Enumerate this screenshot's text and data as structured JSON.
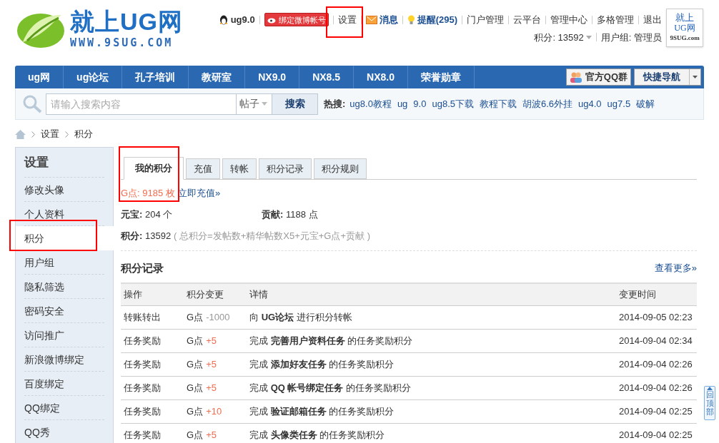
{
  "logo": {
    "title": "就上UG网",
    "url": "WWW.9SUG.COM"
  },
  "header": {
    "user": "ug9.0",
    "weibo_button": "绑定微博帐号",
    "links": [
      {
        "text": "设置",
        "kind": "plain"
      },
      {
        "text": "消息",
        "kind": "message"
      },
      {
        "text": "提醒(295)",
        "kind": "reminder"
      },
      {
        "text": "门户管理",
        "kind": "plain"
      },
      {
        "text": "云平台",
        "kind": "plain"
      },
      {
        "text": "管理中心",
        "kind": "plain"
      },
      {
        "text": "多格管理",
        "kind": "plain"
      },
      {
        "text": "退出",
        "kind": "plain"
      }
    ],
    "points": "积分: 13592",
    "usergroup": "用户组: 管理员",
    "badge": [
      "就上",
      "UG网",
      "9SUG.com"
    ]
  },
  "nav": {
    "items": [
      "ug网",
      "ug论坛",
      "孔子培训",
      "教研室",
      "NX9.0",
      "NX8.5",
      "NX8.0",
      "荣誉勋章"
    ],
    "qq_group": "官方QQ群",
    "quick_nav": "快捷导航"
  },
  "search": {
    "placeholder": "请输入搜索内容",
    "type": "帖子",
    "button": "搜索",
    "hot_label": "热搜:",
    "hot": [
      "ug8.0教程",
      "ug",
      "9.0",
      "ug8.5下载",
      "教程下载",
      "胡波6.6外挂",
      "ug4.0",
      "ug7.5",
      "破解"
    ]
  },
  "breadcrumb": [
    "设置",
    "积分"
  ],
  "sidebar": {
    "title": "设置",
    "items": [
      {
        "label": "修改头像",
        "selected": false
      },
      {
        "label": "个人资料",
        "selected": false
      },
      {
        "label": "积分",
        "selected": true
      },
      {
        "label": "用户组",
        "selected": false
      },
      {
        "label": "隐私筛选",
        "selected": false
      },
      {
        "label": "密码安全",
        "selected": false
      },
      {
        "label": "访问推广",
        "selected": false
      },
      {
        "label": "新浪微博绑定",
        "selected": false
      },
      {
        "label": "百度绑定",
        "selected": false
      },
      {
        "label": "QQ绑定",
        "selected": false
      },
      {
        "label": "QQ秀",
        "selected": false
      }
    ]
  },
  "tabs": [
    {
      "label": "我的积分",
      "selected": true
    },
    {
      "label": "充值",
      "selected": false
    },
    {
      "label": "转帐",
      "selected": false
    },
    {
      "label": "积分记录",
      "selected": false
    },
    {
      "label": "积分规则",
      "selected": false
    }
  ],
  "gpoints": "G点: 9185 枚",
  "recharge_link": "立即充值»",
  "stats": [
    {
      "label": "元宝:",
      "value": "204 个"
    },
    {
      "label": "贡献:",
      "value": "1188 点"
    }
  ],
  "score": {
    "label": "积分:",
    "value": "13592",
    "formula": "( 总积分=发帖数+精华帖数X5+元宝+G点+贡献 )"
  },
  "records": {
    "title": "积分记录",
    "more": "查看更多»",
    "columns": [
      "操作",
      "积分变更",
      "详情",
      "变更时间"
    ],
    "rows": [
      {
        "action": "转账转出",
        "unit": "G点",
        "change": "-1000",
        "kind": "debit",
        "detail": "向 **UG论坛** 进行积分转帐",
        "time": "2014-09-05 02:23"
      },
      {
        "action": "任务奖励",
        "unit": "G点",
        "change": "+5",
        "kind": "credit",
        "detail": "完成 **完善用户资料任务** 的任务奖励积分",
        "time": "2014-09-04 02:34"
      },
      {
        "action": "任务奖励",
        "unit": "G点",
        "change": "+5",
        "kind": "credit",
        "detail": "完成 **添加好友任务** 的任务奖励积分",
        "time": "2014-09-04 02:26"
      },
      {
        "action": "任务奖励",
        "unit": "G点",
        "change": "+5",
        "kind": "credit",
        "detail": "完成 **QQ 帐号绑定任务** 的任务奖励积分",
        "time": "2014-09-04 02:26"
      },
      {
        "action": "任务奖励",
        "unit": "G点",
        "change": "+10",
        "kind": "credit",
        "detail": "完成 **验证邮箱任务** 的任务奖励积分",
        "time": "2014-09-04 02:25"
      },
      {
        "action": "任务奖励",
        "unit": "G点",
        "change": "+5",
        "kind": "credit",
        "detail": "完成 **头像类任务** 的任务奖励积分",
        "time": "2014-09-04 02:25"
      }
    ]
  },
  "back_to_top": "回顶部"
}
